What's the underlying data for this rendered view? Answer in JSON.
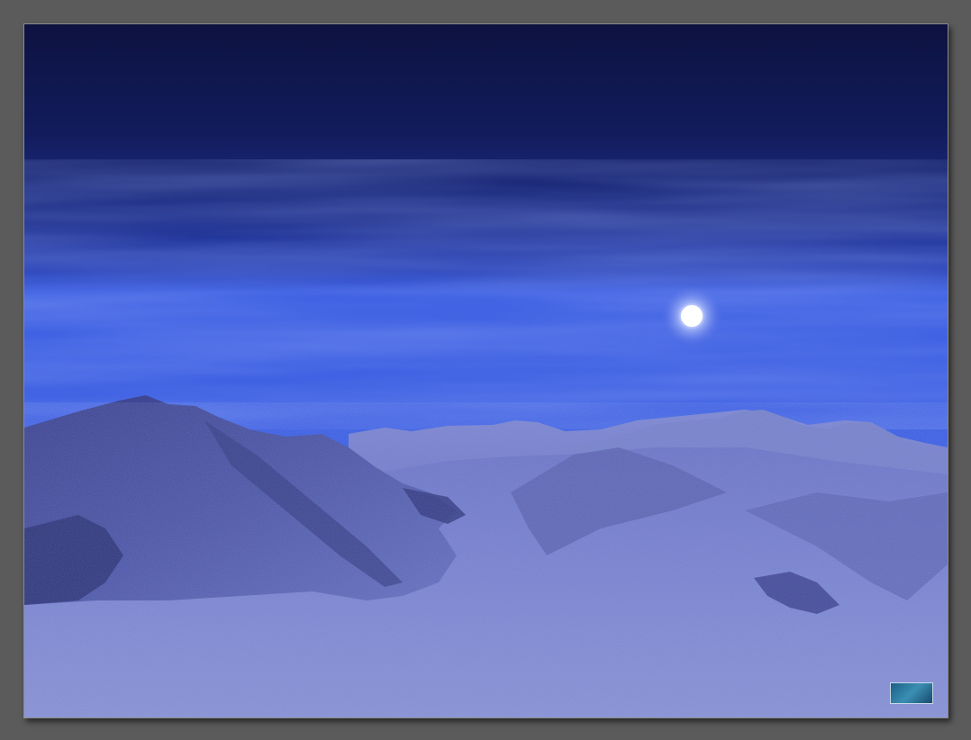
{
  "image": {
    "subject": "",
    "palette": {
      "frame": "#5b5b5b",
      "sky_top": "#0e1442",
      "sky_mid": "#20338f",
      "horizon": "#3a5ce0",
      "snow_light": "#8f99d6",
      "snow_dark": "#2a3276",
      "moon": "#ffffff"
    }
  },
  "watermark": {
    "icon": "signature-logo-icon"
  }
}
